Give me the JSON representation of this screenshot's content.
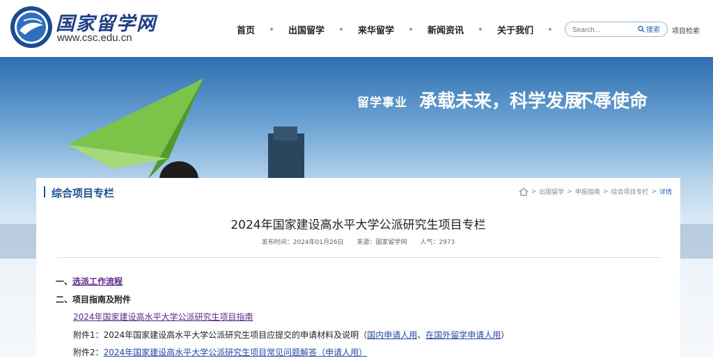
{
  "header": {
    "logo_title": "国家留学网",
    "logo_url": "www.csc.edu.cn",
    "nav": [
      "首页",
      "出国留学",
      "来华留学",
      "新闻资讯",
      "关于我们"
    ],
    "search_placeholder": "Search...",
    "search_button": "搜索",
    "project_search": "项目检索"
  },
  "banner": {
    "slogan_1": "留学事业",
    "slogan_2": "承载未来，科学发展",
    "slogan_3": "不辱使命"
  },
  "section": {
    "title": "综合项目专栏",
    "breadcrumb": [
      "出国留学",
      "申报指南",
      "综合项目专栏",
      "详情"
    ]
  },
  "article": {
    "title": "2024年国家建设高水平大学公派研究生项目专栏",
    "publish_label": "发布时间：",
    "publish_date": "2024年01月26日",
    "source_label": "来源：",
    "source": "国家留学网",
    "views_label": "人气：",
    "views": "2973",
    "item1_prefix": "一、",
    "item1_link": "选派工作流程",
    "item2": "二、项目指南及附件",
    "guide_link": "2024年国家建设高水平大学公派研究生项目指南",
    "att1_prefix": "附件1：",
    "att1_text": "2024年国家建设高水平大学公派研究生项目应提交的申请材料及说明（",
    "att1_link1": "国内申请人用",
    "att1_sep": "、",
    "att1_link2": "在国外留学申请人用",
    "att1_close": "）",
    "att2_prefix": "附件2：",
    "att2_link": "2024年国家建设高水平大学公派研究生项目常见问题解答（申请人用）"
  },
  "colors": {
    "brand": "#1d4f91",
    "link": "#5b2a8f",
    "link_blue": "#2449a8"
  }
}
